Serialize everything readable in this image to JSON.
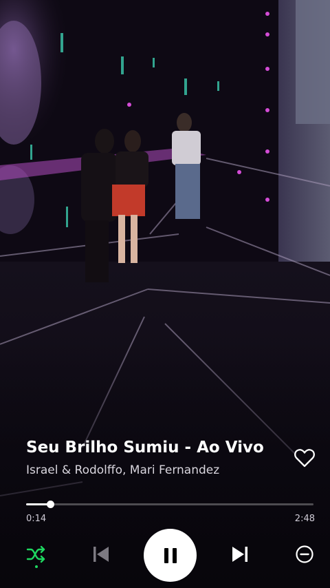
{
  "track": {
    "title": "Seu Brilho Sumiu - Ao Vivo",
    "artist": "Israel & Rodolffo, Mari Fernandez"
  },
  "playback": {
    "elapsed": "0:14",
    "total": "2:48",
    "progress_fraction": 0.083,
    "state": "playing"
  },
  "icons": {
    "like": "heart-outline-icon",
    "shuffle": "shuffle-icon",
    "previous": "skip-previous-icon",
    "play_pause": "pause-icon",
    "next": "skip-next-icon",
    "remove": "minus-circle-icon"
  },
  "colors": {
    "shuffle_active": "#1ed760",
    "prev_disabled": "#7d7a82"
  }
}
